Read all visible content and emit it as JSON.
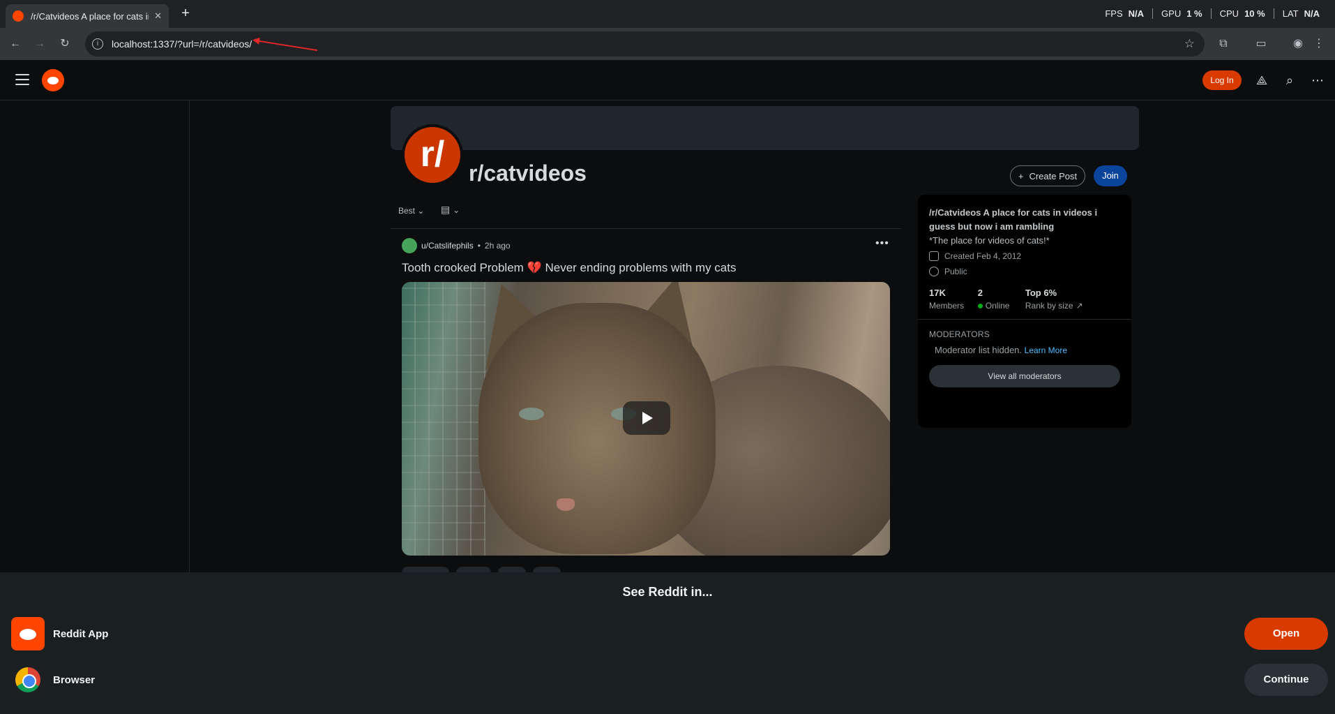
{
  "browser": {
    "tab_title": "/r/Catvideos A place for cats in",
    "tab_close": "✕",
    "new_tab": "+",
    "url": "localhost:1337/?url=/r/catvideos/",
    "perf": [
      {
        "label": "FPS",
        "value": "N/A"
      },
      {
        "label": "GPU",
        "value": "1 %"
      },
      {
        "label": "CPU",
        "value": "10 %"
      },
      {
        "label": "LAT",
        "value": "N/A"
      }
    ]
  },
  "header": {
    "login_label": "Log In"
  },
  "community": {
    "avatar_text": "r/",
    "name": "r/catvideos",
    "create_post_label": "Create Post",
    "join_label": "Join"
  },
  "feed": {
    "sort_label": "Best"
  },
  "post": {
    "author": "u/Catslifephils",
    "separator": "•",
    "time": "2h ago",
    "title_part1": "Tooth crooked Problem",
    "emoji": "💔",
    "title_part2": "Never ending problems with my cats"
  },
  "sidebar": {
    "title": "/r/Catvideos A place for cats in videos i guess but now i am rambling",
    "description": "*The place for videos of cats!*",
    "created": "Created Feb 4, 2012",
    "visibility": "Public",
    "stats": [
      {
        "value": "17K",
        "label": "Members"
      },
      {
        "value": "2",
        "label": "Online"
      },
      {
        "value": "Top 6%",
        "label": "Rank by size"
      }
    ],
    "moderators_heading": "MODERATORS",
    "moderators_text": "Moderator list hidden.",
    "learn_more": "Learn More",
    "view_all_mods": "View all moderators"
  },
  "sheet": {
    "title": "See Reddit in...",
    "options": [
      {
        "label": "Reddit App",
        "action": "Open"
      },
      {
        "label": "Browser",
        "action": "Continue"
      }
    ]
  },
  "colors": {
    "reddit_orange": "#ff4500",
    "login_button": "#d93a00",
    "join_button": "#0a449b",
    "online_dot": "#01a816"
  }
}
